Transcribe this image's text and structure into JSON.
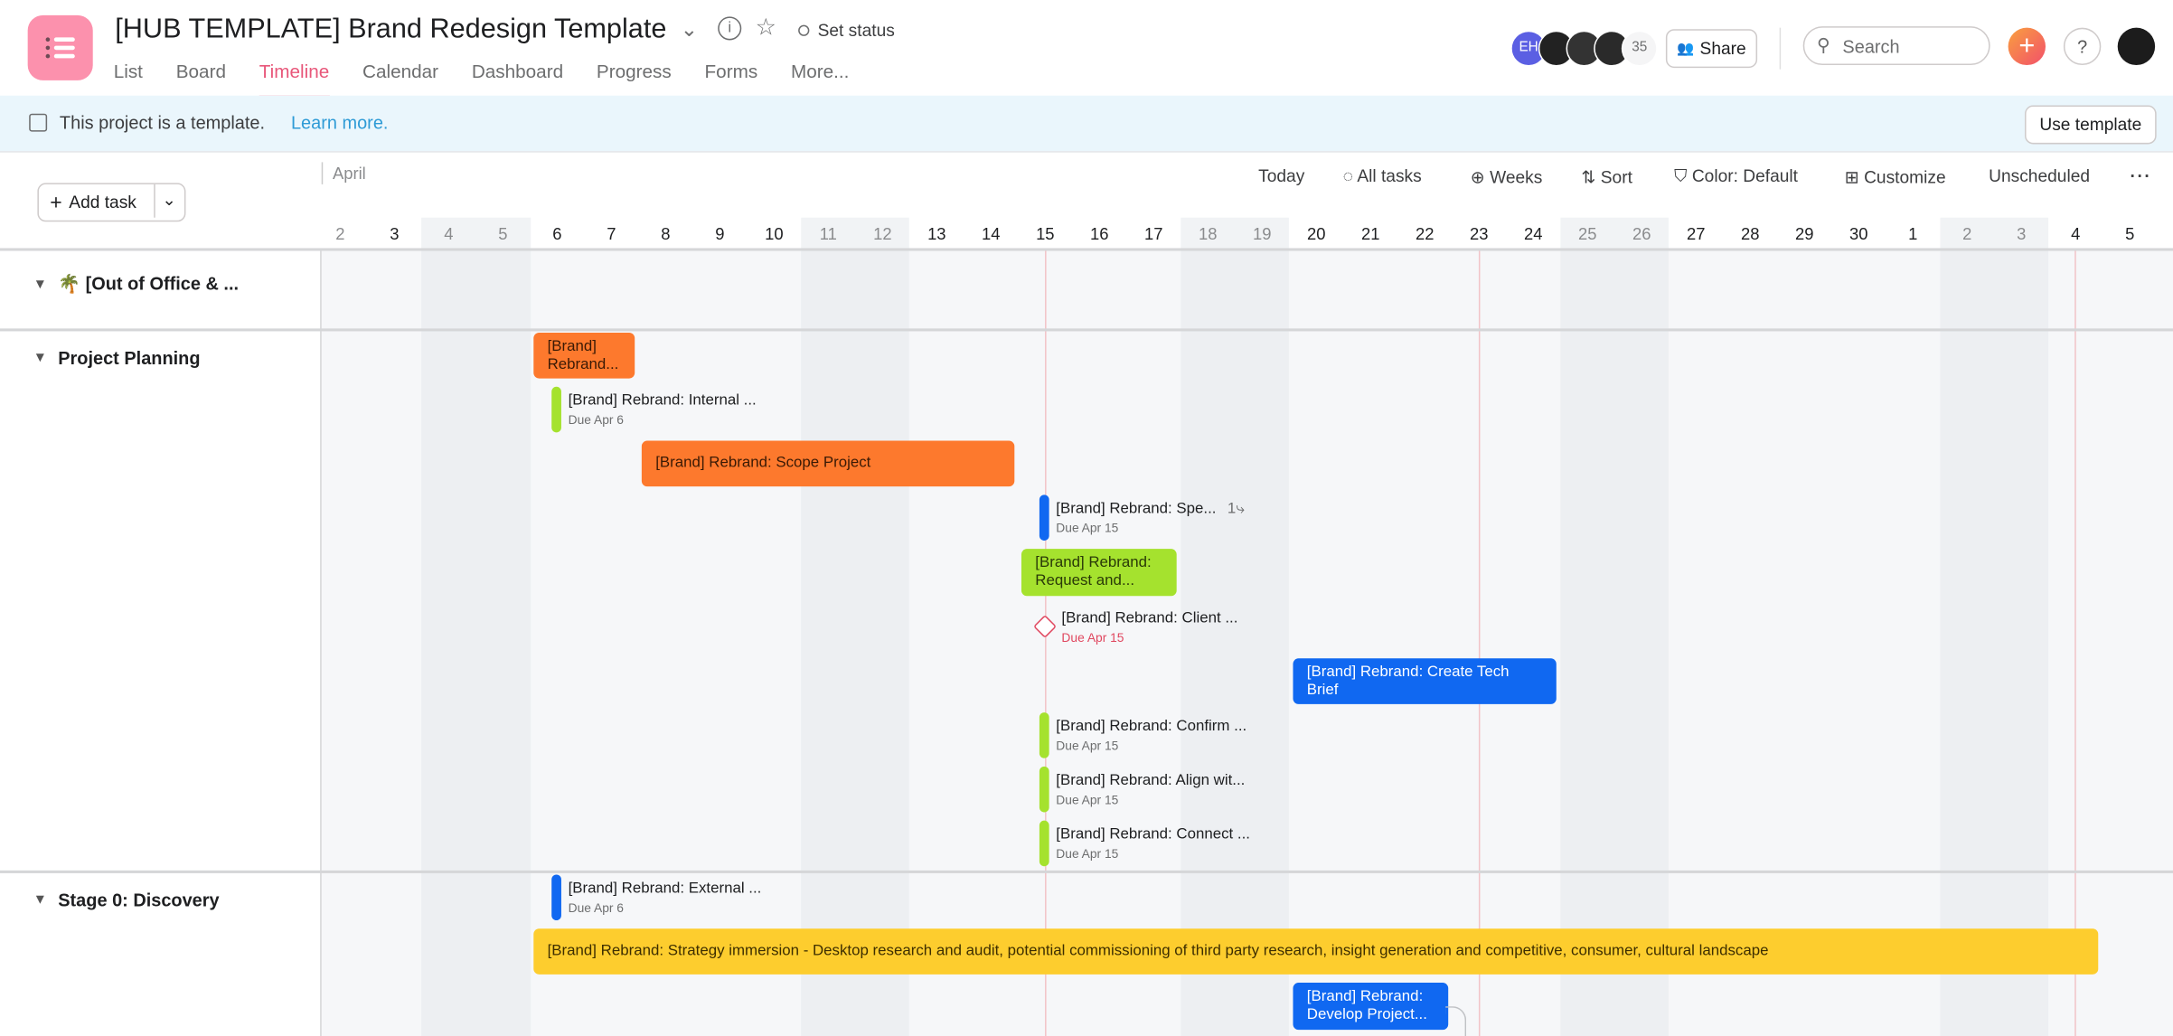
{
  "header": {
    "title": "[HUB TEMPLATE] Brand Redesign Template",
    "set_status": "Set status",
    "tabs": [
      "List",
      "Board",
      "Timeline",
      "Calendar",
      "Dashboard",
      "Progress",
      "Forms",
      "More..."
    ],
    "active_tab": "Timeline",
    "avatar_initials": "EH",
    "member_count": "35",
    "share": "Share",
    "search_placeholder": "Search",
    "help": "?"
  },
  "banner": {
    "text": "This project is a template.",
    "link": "Learn more.",
    "button": "Use template"
  },
  "toolbar": {
    "add_task": "Add task",
    "month": "April",
    "today": "Today",
    "all_tasks": "All tasks",
    "weeks": "Weeks",
    "sort": "Sort",
    "color": "Color: Default",
    "customize": "Customize",
    "unscheduled": "Unscheduled"
  },
  "days": [
    "2",
    "3",
    "4",
    "5",
    "6",
    "7",
    "8",
    "9",
    "10",
    "11",
    "12",
    "13",
    "14",
    "15",
    "16",
    "17",
    "18",
    "19",
    "20",
    "21",
    "22",
    "23",
    "24",
    "25",
    "26",
    "27",
    "28",
    "29",
    "30",
    "1",
    "2",
    "3",
    "4",
    "5"
  ],
  "sections": [
    "🌴 [Out of Office & ...",
    "Project Planning",
    "Stage 0: Discovery"
  ],
  "tasks": [
    {
      "name": "[Brand] Rebrand...",
      "color": "#fd792d"
    },
    {
      "name": "[Brand] Rebrand: Internal ...",
      "due": "Due Apr 6",
      "color": "#a5e22e"
    },
    {
      "name": "[Brand] Rebrand: Scope Project",
      "color": "#fd792d"
    },
    {
      "name": "[Brand] Rebrand: Spe...",
      "due": "Due Apr 15",
      "subtasks": "1",
      "color": "#1068f1"
    },
    {
      "name": "[Brand] Rebrand: Request and...",
      "color": "#a5e22e"
    },
    {
      "name": "[Brand] Rebrand: Client ...",
      "due": "Due Apr 15",
      "type": "milestone",
      "color": "#e0475f"
    },
    {
      "name": "[Brand] Rebrand: Create Tech Brief",
      "color": "#1068f1"
    },
    {
      "name": "[Brand] Rebrand: Confirm ...",
      "due": "Due Apr 15",
      "color": "#a5e22e"
    },
    {
      "name": "[Brand] Rebrand: Align wit...",
      "due": "Due Apr 15",
      "color": "#a5e22e"
    },
    {
      "name": "[Brand] Rebrand: Connect ...",
      "due": "Due Apr 15",
      "color": "#a5e22e"
    },
    {
      "name": "[Brand] Rebrand: External ...",
      "due": "Due Apr 6",
      "color": "#1068f1"
    },
    {
      "name": "[Brand] Rebrand: Strategy immersion - Desktop research and audit, potential commissioning of third party research, insight generation and competitive, consumer, cultural landscape",
      "color": "#fdcd2e"
    },
    {
      "name": "[Brand] Rebrand: Develop Project...",
      "color": "#1068f1"
    }
  ]
}
